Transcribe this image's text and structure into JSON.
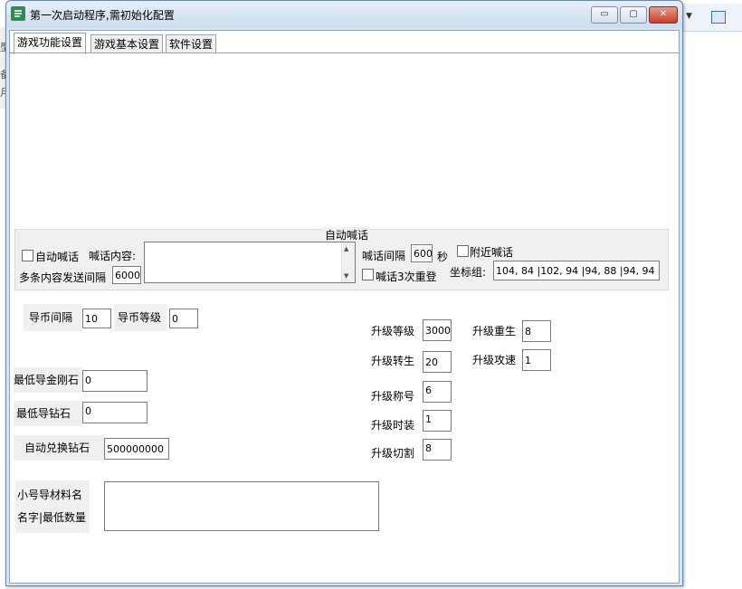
{
  "background_app": {
    "left_text": [
      "型",
      "备",
      "月"
    ]
  },
  "window": {
    "title": "第一次启动程序,需初始化配置",
    "minimize_label": "▭",
    "maximize_label": "▢",
    "close_label": "✕"
  },
  "tabs": [
    {
      "label": "游戏功能设置",
      "active": true
    },
    {
      "label": "游戏基本设置",
      "active": false
    },
    {
      "label": "软件设置",
      "active": false
    }
  ],
  "shout": {
    "group_title": "自动喊话",
    "auto_shout_label": "自动喊话",
    "content_label": "喊话内容:",
    "multi_interval_label": "多条内容发送间隔",
    "multi_interval_value": "6000",
    "interval_label": "喊话间隔",
    "interval_value": "600",
    "seconds_label": "秒",
    "nearby_label": "附近喊话",
    "triple_relogin_label": "喊话3次重登",
    "coords_label": "坐标组:",
    "coords_value": "104, 84 |102, 94 |94, 88 |94, 94"
  },
  "coin": {
    "interval_label": "导币间隔",
    "interval_value": "10",
    "level_label": "导币等级",
    "level_value": "0"
  },
  "upgrade": {
    "level_label": "升级等级",
    "level_value": "3000",
    "rebirth_label": "升级重生",
    "rebirth_value": "8",
    "transfer_label": "升级转生",
    "transfer_value": "20",
    "attack_speed_label": "升级攻速",
    "attack_speed_value": "1",
    "title_label": "升级称号",
    "title_value": "6",
    "fashion_label": "升级时装",
    "fashion_value": "1",
    "cut_label": "升级切割",
    "cut_value": "8"
  },
  "min": {
    "diamond_stone_label": "最低导金刚石",
    "diamond_stone_value": "0",
    "drill_label": "最低导钻石",
    "drill_value": "0",
    "auto_exchange_label": "自动兑换钻石",
    "auto_exchange_value": "500000000"
  },
  "alt": {
    "material_label": "小号导材料名",
    "name_min_label": "名字|最低数量"
  }
}
